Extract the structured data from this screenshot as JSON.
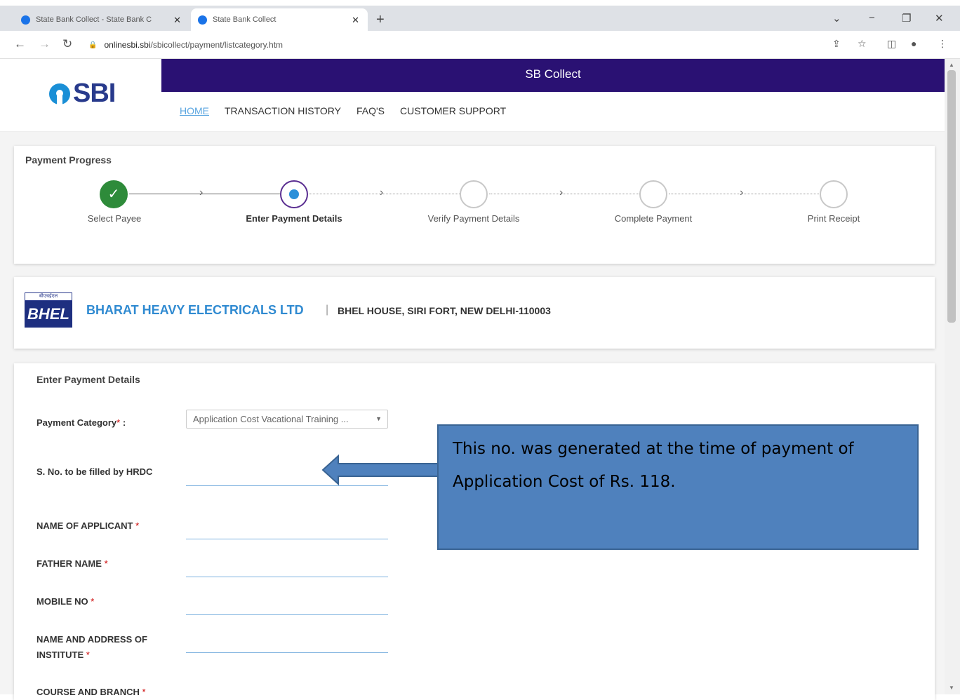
{
  "browser": {
    "tabs": [
      {
        "title": "State Bank Collect - State Bank C",
        "active": false
      },
      {
        "title": "State Bank Collect",
        "active": true
      }
    ],
    "url_host": "onlinesbi.sbi",
    "url_path": "/sbicollect/payment/listcategory.htm"
  },
  "header": {
    "logo_text": "SBI",
    "band_title": "SB Collect",
    "menu": [
      "HOME",
      "TRANSACTION HISTORY",
      "FAQ'S",
      "CUSTOMER SUPPORT"
    ]
  },
  "progress": {
    "title": "Payment Progress",
    "steps": [
      {
        "label": "Select Payee",
        "state": "done"
      },
      {
        "label": "Enter Payment Details",
        "state": "current"
      },
      {
        "label": "Verify Payment Details",
        "state": "pending"
      },
      {
        "label": "Complete Payment",
        "state": "pending"
      },
      {
        "label": "Print Receipt",
        "state": "pending"
      }
    ]
  },
  "org": {
    "logo_small": "बीएचईएल",
    "logo_text": "BHEL",
    "name": "BHARAT HEAVY ELECTRICALS LTD",
    "separator": "|",
    "address": "BHEL HOUSE, SIRI FORT, NEW DELHI-110003"
  },
  "form": {
    "title": "Enter Payment Details",
    "payment_category_label": "Payment Category",
    "payment_category_colon": ":",
    "payment_category_value": "Application Cost Vacational Training ...",
    "fields": [
      {
        "label": "S. No. to be filled by HRDC",
        "required": false
      },
      {
        "label": "NAME OF APPLICANT",
        "required": true
      },
      {
        "label": "FATHER NAME",
        "required": true
      },
      {
        "label": "MOBILE NO",
        "required": true
      },
      {
        "label": "NAME AND ADDRESS OF INSTITUTE",
        "required": true
      },
      {
        "label": "COURSE AND BRANCH",
        "required": true
      }
    ]
  },
  "callout": {
    "text": "This no. was generated at the time of payment of Application Cost of Rs. 118."
  },
  "colors": {
    "band": "#2a1173",
    "done": "#2e8b3a",
    "current_ring": "#5a2e91",
    "accent_blue": "#2f8ad1",
    "callout_fill": "#4f81bd"
  }
}
